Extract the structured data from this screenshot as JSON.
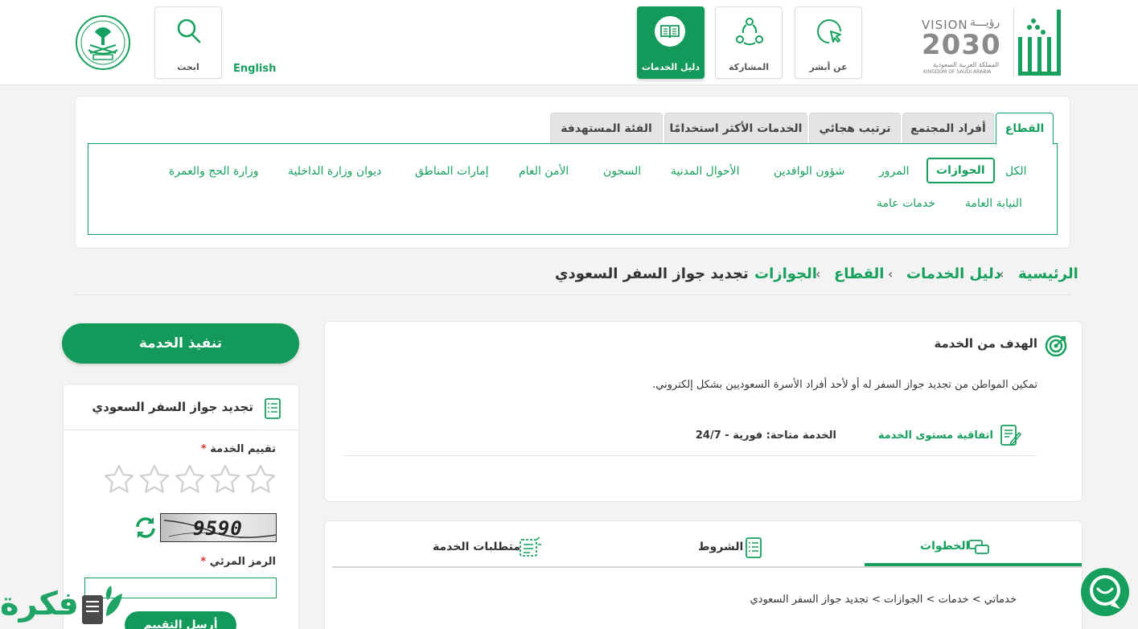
{
  "header": {
    "vision": {
      "line1": "VISION",
      "line1_ar": "رؤيـــة",
      "year": "2030",
      "line2_ar": "المملكة العربية السعودية",
      "line3": "KINGDOM OF SAUDI ARABIA"
    },
    "nav": [
      {
        "label": "عن أبشر",
        "icon": "pointer-icon"
      },
      {
        "label": "المشاركة",
        "icon": "network-icon"
      },
      {
        "label": "دليل الخدمات",
        "icon": "book-icon",
        "active": true
      }
    ],
    "english_link": "English",
    "search_label": "ابحث"
  },
  "category_tabs": [
    {
      "label": "القطاع",
      "active": true
    },
    {
      "label": "أفراد المجتمع"
    },
    {
      "label": "ترتيب هجائي"
    },
    {
      "label": "الخدمات الأكثر استخدامًا"
    },
    {
      "label": "الفئة المستهدفة"
    }
  ],
  "sectors": [
    {
      "label": "الكل"
    },
    {
      "label": "الجوازات",
      "active": true
    },
    {
      "label": "المرور"
    },
    {
      "label": "شؤون الوافدين"
    },
    {
      "label": "الأحوال المدنية"
    },
    {
      "label": "السجون"
    },
    {
      "label": "الأمن العام"
    },
    {
      "label": "إمارات المناطق"
    },
    {
      "label": "ديوان وزارة الداخلية"
    },
    {
      "label": "وزارة الحج والعمرة"
    },
    {
      "label": "النيابة العامة"
    },
    {
      "label": "خدمات عامة"
    }
  ],
  "breadcrumb": [
    "الرئيسية",
    "دليل الخدمات",
    "القطاع",
    "الجوازات",
    "تجديد جواز السفر السعودي"
  ],
  "goal": {
    "title": "الهدف من الخدمة",
    "description": "تمكين المواطن من تجديد جواز السفر له أو لأحد أفراد الأسرة السعوديين بشكل إلكتروني.",
    "sla_label": "اتفاقية مستوى الخدمة",
    "availability": "الخدمة متاحة: فورية - 24/7"
  },
  "info_tabs": [
    {
      "label": "الخطوات",
      "active": true
    },
    {
      "label": "الشروط"
    },
    {
      "label": "متطلبات الخدمة"
    }
  ],
  "steps_text": "خدماتي > خدمات > الجوازات > تجديد جواز السفر السعودي",
  "execute_button": "تنفيذ الخدمة",
  "rating_card": {
    "service_name": "تجديد جواز السفر السعودي",
    "rating_label": "تقييم الخدمة",
    "required_mark": "*",
    "stars": 5,
    "rating_value": 0,
    "captcha_text": "9590",
    "captcha_label": "الرمز المرئي",
    "captcha_input_value": "",
    "submit_label": "أرسل التقييم"
  },
  "watermark": "فكرة",
  "colors": {
    "primary": "#17a05d",
    "dark_primary": "#139a5b"
  }
}
